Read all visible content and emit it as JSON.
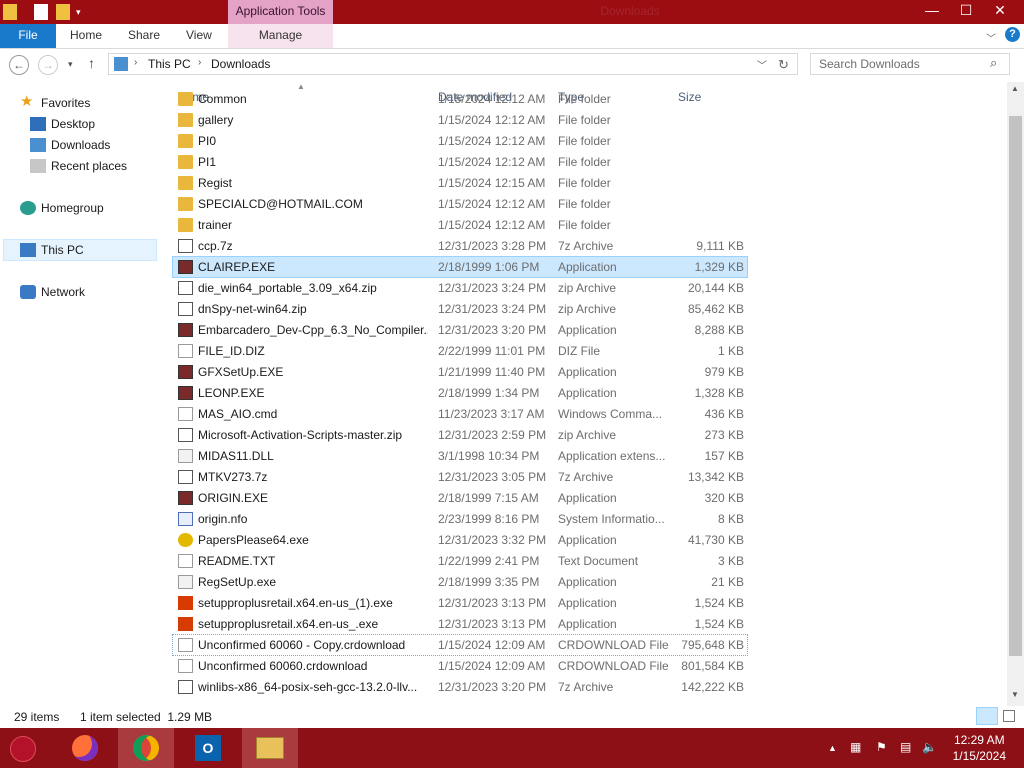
{
  "window": {
    "contextual_tab_group": "Application Tools",
    "title": "Downloads",
    "controls": {
      "minimize": "—",
      "maximize": "☐",
      "close": "✕"
    }
  },
  "ribbon": {
    "tabs": [
      "File",
      "Home",
      "Share",
      "View",
      "Manage"
    ]
  },
  "address": {
    "crumbs": [
      "This PC",
      "Downloads"
    ],
    "search_placeholder": "Search Downloads"
  },
  "nav": {
    "favorites": "Favorites",
    "desktop": "Desktop",
    "downloads": "Downloads",
    "recent": "Recent places",
    "homegroup": "Homegroup",
    "thispc": "This PC",
    "network": "Network"
  },
  "columns": {
    "name": "Name",
    "date": "Date modified",
    "type": "Type",
    "size": "Size"
  },
  "files": [
    {
      "name": "Common",
      "date": "1/15/2024 12:12 AM",
      "type": "File folder",
      "size": "",
      "icon": "folder"
    },
    {
      "name": "gallery",
      "date": "1/15/2024 12:12 AM",
      "type": "File folder",
      "size": "",
      "icon": "folder"
    },
    {
      "name": "PI0",
      "date": "1/15/2024 12:12 AM",
      "type": "File folder",
      "size": "",
      "icon": "folder"
    },
    {
      "name": "PI1",
      "date": "1/15/2024 12:12 AM",
      "type": "File folder",
      "size": "",
      "icon": "folder"
    },
    {
      "name": "Regist",
      "date": "1/15/2024 12:15 AM",
      "type": "File folder",
      "size": "",
      "icon": "folder"
    },
    {
      "name": "SPECIALCD@HOTMAIL.COM",
      "date": "1/15/2024 12:12 AM",
      "type": "File folder",
      "size": "",
      "icon": "folder"
    },
    {
      "name": "trainer",
      "date": "1/15/2024 12:12 AM",
      "type": "File folder",
      "size": "",
      "icon": "folder"
    },
    {
      "name": "ccp.7z",
      "date": "12/31/2023 3:28 PM",
      "type": "7z Archive",
      "size": "9,111 KB",
      "icon": "archive"
    },
    {
      "name": "CLAIREP.EXE",
      "date": "2/18/1999 1:06 PM",
      "type": "Application",
      "size": "1,329 KB",
      "icon": "app",
      "selected": true
    },
    {
      "name": "die_win64_portable_3.09_x64.zip",
      "date": "12/31/2023 3:24 PM",
      "type": "zip Archive",
      "size": "20,144 KB",
      "icon": "archive"
    },
    {
      "name": "dnSpy-net-win64.zip",
      "date": "12/31/2023 3:24 PM",
      "type": "zip Archive",
      "size": "85,462 KB",
      "icon": "archive"
    },
    {
      "name": "Embarcadero_Dev-Cpp_6.3_No_Compiler...",
      "date": "12/31/2023 3:20 PM",
      "type": "Application",
      "size": "8,288 KB",
      "icon": "app"
    },
    {
      "name": "FILE_ID.DIZ",
      "date": "2/22/1999 11:01 PM",
      "type": "DIZ File",
      "size": "1 KB",
      "icon": "file"
    },
    {
      "name": "GFXSetUp.EXE",
      "date": "1/21/1999 11:40 PM",
      "type": "Application",
      "size": "979 KB",
      "icon": "app"
    },
    {
      "name": "LEONP.EXE",
      "date": "2/18/1999 1:34 PM",
      "type": "Application",
      "size": "1,328 KB",
      "icon": "app"
    },
    {
      "name": "MAS_AIO.cmd",
      "date": "11/23/2023 3:17 AM",
      "type": "Windows Comma...",
      "size": "436 KB",
      "icon": "file"
    },
    {
      "name": "Microsoft-Activation-Scripts-master.zip",
      "date": "12/31/2023 2:59 PM",
      "type": "zip Archive",
      "size": "273 KB",
      "icon": "archive"
    },
    {
      "name": "MIDAS11.DLL",
      "date": "3/1/1998 10:34 PM",
      "type": "Application extens...",
      "size": "157 KB",
      "icon": "dll"
    },
    {
      "name": "MTKV273.7z",
      "date": "12/31/2023 3:05 PM",
      "type": "7z Archive",
      "size": "13,342 KB",
      "icon": "archive"
    },
    {
      "name": "ORIGIN.EXE",
      "date": "2/18/1999 7:15 AM",
      "type": "Application",
      "size": "320 KB",
      "icon": "app"
    },
    {
      "name": "origin.nfo",
      "date": "2/23/1999 8:16 PM",
      "type": "System Informatio...",
      "size": "8 KB",
      "icon": "info"
    },
    {
      "name": "PapersPlease64.exe",
      "date": "12/31/2023 3:32 PM",
      "type": "Application",
      "size": "41,730 KB",
      "icon": "disc"
    },
    {
      "name": "README.TXT",
      "date": "1/22/1999 2:41 PM",
      "type": "Text Document",
      "size": "3 KB",
      "icon": "file"
    },
    {
      "name": "RegSetUp.exe",
      "date": "2/18/1999 3:35 PM",
      "type": "Application",
      "size": "21 KB",
      "icon": "dll"
    },
    {
      "name": "setupproplusretail.x64.en-us_(1).exe",
      "date": "12/31/2023 3:13 PM",
      "type": "Application",
      "size": "1,524 KB",
      "icon": "office"
    },
    {
      "name": "setupproplusretail.x64.en-us_.exe",
      "date": "12/31/2023 3:13 PM",
      "type": "Application",
      "size": "1,524 KB",
      "icon": "office"
    },
    {
      "name": "Unconfirmed 60060 - Copy.crdownload",
      "date": "1/15/2024 12:09 AM",
      "type": "CRDOWNLOAD File",
      "size": "795,648 KB",
      "icon": "file",
      "focused": true
    },
    {
      "name": "Unconfirmed 60060.crdownload",
      "date": "1/15/2024 12:09 AM",
      "type": "CRDOWNLOAD File",
      "size": "801,584 KB",
      "icon": "file"
    },
    {
      "name": "winlibs-x86_64-posix-seh-gcc-13.2.0-llv...",
      "date": "12/31/2023 3:20 PM",
      "type": "7z Archive",
      "size": "142,222 KB",
      "icon": "archive"
    }
  ],
  "status": {
    "count": "29 items",
    "selection": "1 item selected  1.29 MB"
  },
  "taskbar": {
    "time": "12:29 AM",
    "date": "1/15/2024"
  },
  "colors": {
    "accent": "#1979ca",
    "taskbar": "#8c1016",
    "titlebar": "#9c0d12",
    "selection": "#cce8ff"
  }
}
